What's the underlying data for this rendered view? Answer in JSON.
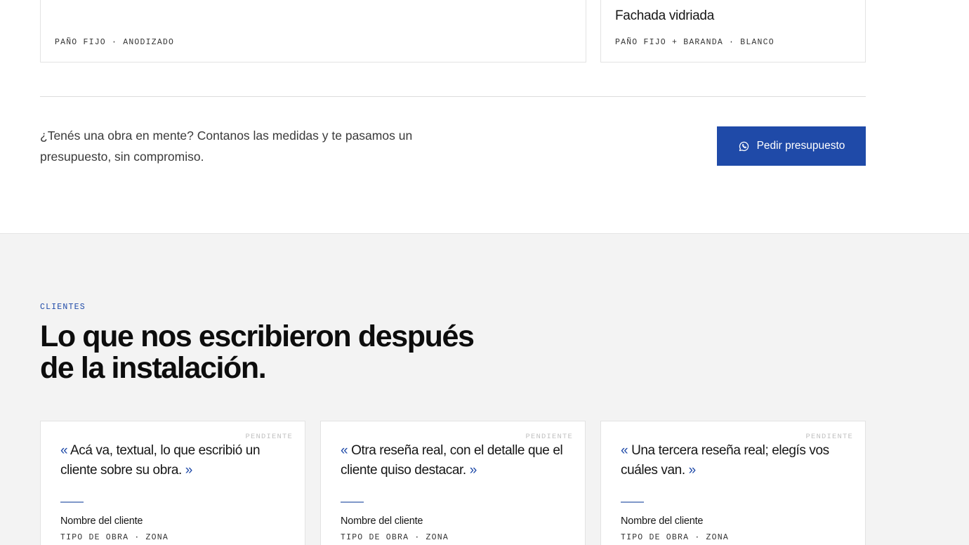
{
  "projects": [
    {
      "title": "",
      "meta": "PAÑO FIJO · ANODIZADO"
    },
    {
      "title": "Fachada vidriada",
      "meta": "PAÑO FIJO + BARANDA · BLANCO"
    }
  ],
  "cta": {
    "text": "¿Tenés una obra en mente? Contanos las medidas y te pasamos un presupuesto, sin compromiso.",
    "button_label": "Pedir presupuesto",
    "button_icon": "whatsapp-icon"
  },
  "clients": {
    "eyebrow": "CLIENTES",
    "headline": "Lo que nos escribieron después de la instalación.",
    "reviews": [
      {
        "status": "PENDIENTE",
        "open_quote": "«",
        "quote": "Acá va, textual, lo que escribió un cliente sobre su obra.",
        "close_quote": "»",
        "name": "Nombre del cliente",
        "meta": "TIPO DE OBRA · ZONA"
      },
      {
        "status": "PENDIENTE",
        "open_quote": "«",
        "quote": "Otra reseña real, con el detalle que el cliente quiso destacar.",
        "close_quote": "»",
        "name": "Nombre del cliente",
        "meta": "TIPO DE OBRA · ZONA"
      },
      {
        "status": "PENDIENTE",
        "open_quote": "«",
        "quote": "Una tercera reseña real; elegís vos cuáles van.",
        "close_quote": "»",
        "name": "Nombre del cliente",
        "meta": "TIPO DE OBRA · ZONA"
      }
    ]
  },
  "colors": {
    "accent": "#1f4aa8",
    "section_bg": "#f3f3f3"
  }
}
